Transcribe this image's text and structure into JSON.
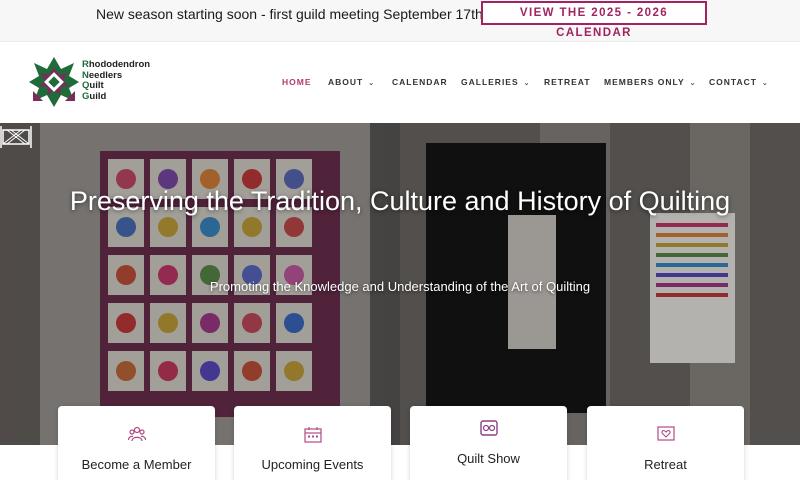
{
  "announcement": {
    "text": "New season starting soon - first guild meeting September 17th!",
    "button_label": "VIEW THE 2025 - 2026 CALENDAR"
  },
  "logo": {
    "lines": [
      "Rhododendron",
      "Needlers",
      "Quilt",
      "Guild"
    ],
    "initials": [
      "R",
      "N",
      "Q",
      "G"
    ],
    "rest": [
      "hododendron",
      "eedlers",
      "uilt",
      "uild"
    ]
  },
  "nav": {
    "items": [
      {
        "label": "HOME",
        "active": true,
        "has_dropdown": false
      },
      {
        "label": "ABOUT",
        "active": false,
        "has_dropdown": true
      },
      {
        "label": "CALENDAR",
        "active": false,
        "has_dropdown": false
      },
      {
        "label": "GALLERIES",
        "active": false,
        "has_dropdown": true
      },
      {
        "label": "RETREAT",
        "active": false,
        "has_dropdown": false
      },
      {
        "label": "MEMBERS ONLY",
        "active": false,
        "has_dropdown": true
      },
      {
        "label": "CONTACT",
        "active": false,
        "has_dropdown": true
      }
    ]
  },
  "hero": {
    "title": "Preserving the Tradition, Culture and History of Quilting",
    "subtitle": "Promoting the Knowledge and Understanding of the Art of Quilting",
    "icon": "quilt-frame-icon"
  },
  "cards": [
    {
      "label": "Become a Member",
      "icon": "people-icon"
    },
    {
      "label": "Upcoming Events",
      "icon": "calendar-icon"
    },
    {
      "label": "Quilt Show",
      "icon": "quilt-icon"
    },
    {
      "label": "Retreat",
      "icon": "heart-frame-icon"
    }
  ],
  "colors": {
    "accent": "#a2235f",
    "nav_active": "#b23a6f",
    "logo_green": "#1f6b3a",
    "logo_purple": "#7a2c5a",
    "card_icon": "#b04a85"
  }
}
